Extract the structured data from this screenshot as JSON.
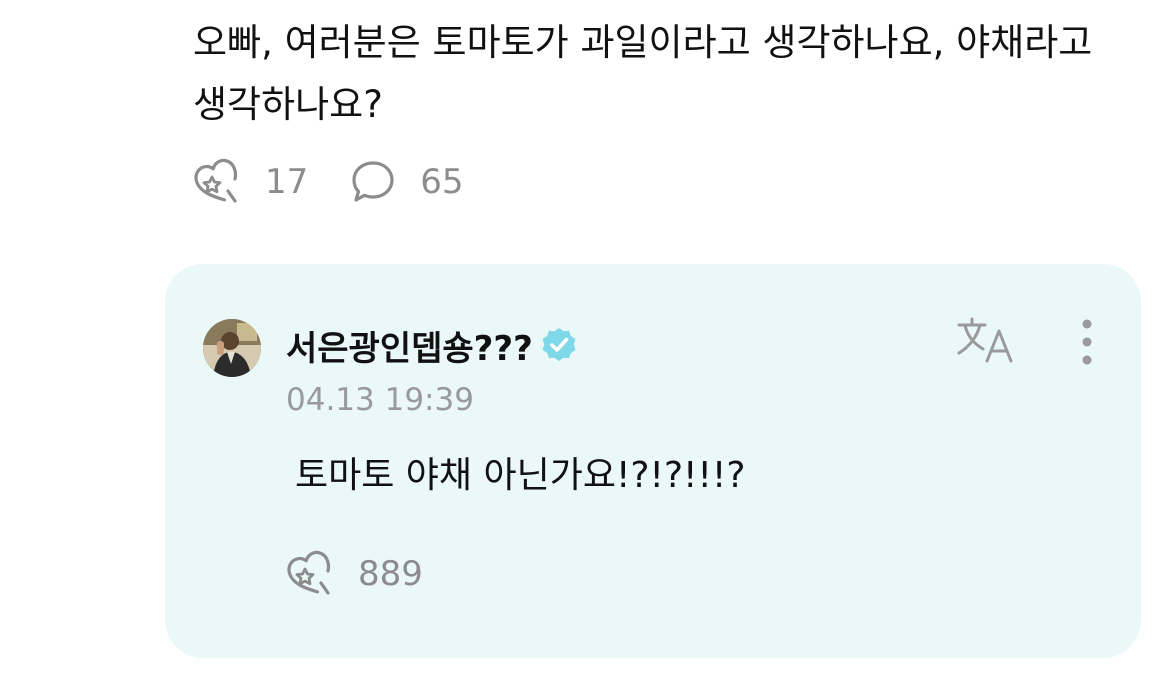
{
  "post": {
    "text": "오빠, 여러분은 토마토가 과일이라고 생각하나요, 야채라고 생각하나요?",
    "like_count": "17",
    "comment_count": "65",
    "like_icon": "heart-star-icon",
    "comment_icon": "speech-bubble-icon"
  },
  "reply": {
    "author_name": "서은광인뎁숑???",
    "verified_icon": "verified-badge-icon",
    "verified_color": "#7fd8e8",
    "timestamp": "04.13 19:39",
    "text": "토마토 야채 아닌가요!?!?!!!?",
    "like_count": "889",
    "translate_icon": "translate-icon",
    "more_icon": "more-vertical-icon",
    "background_color": "#eaf8f7"
  },
  "colors": {
    "text_primary": "#111111",
    "text_secondary": "#8c8c8c",
    "icon_gray": "#9a9a9a"
  }
}
